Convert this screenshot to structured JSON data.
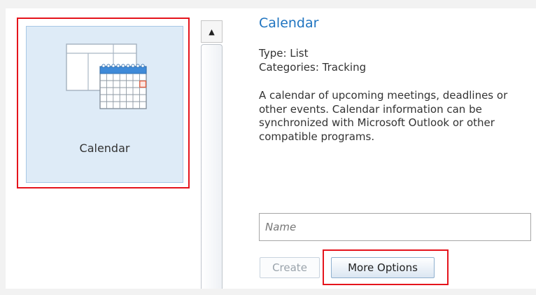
{
  "tile": {
    "label": "Calendar",
    "icon": "calendar-icon"
  },
  "scrollbar": {
    "up_arrow": "▲"
  },
  "detail": {
    "title": "Calendar",
    "type": "Type: List",
    "categories": "Categories: Tracking",
    "description": "A calendar of upcoming meetings, deadlines or other events.  Calendar information can be synchronized with Microsoft Outlook or other compatible programs."
  },
  "form": {
    "name_placeholder": "Name",
    "create_label": "Create",
    "more_options_label": "More Options"
  },
  "colors": {
    "accent": "#1f74c0",
    "highlight": "#e5141c",
    "tile_bg": "#deebf7"
  }
}
